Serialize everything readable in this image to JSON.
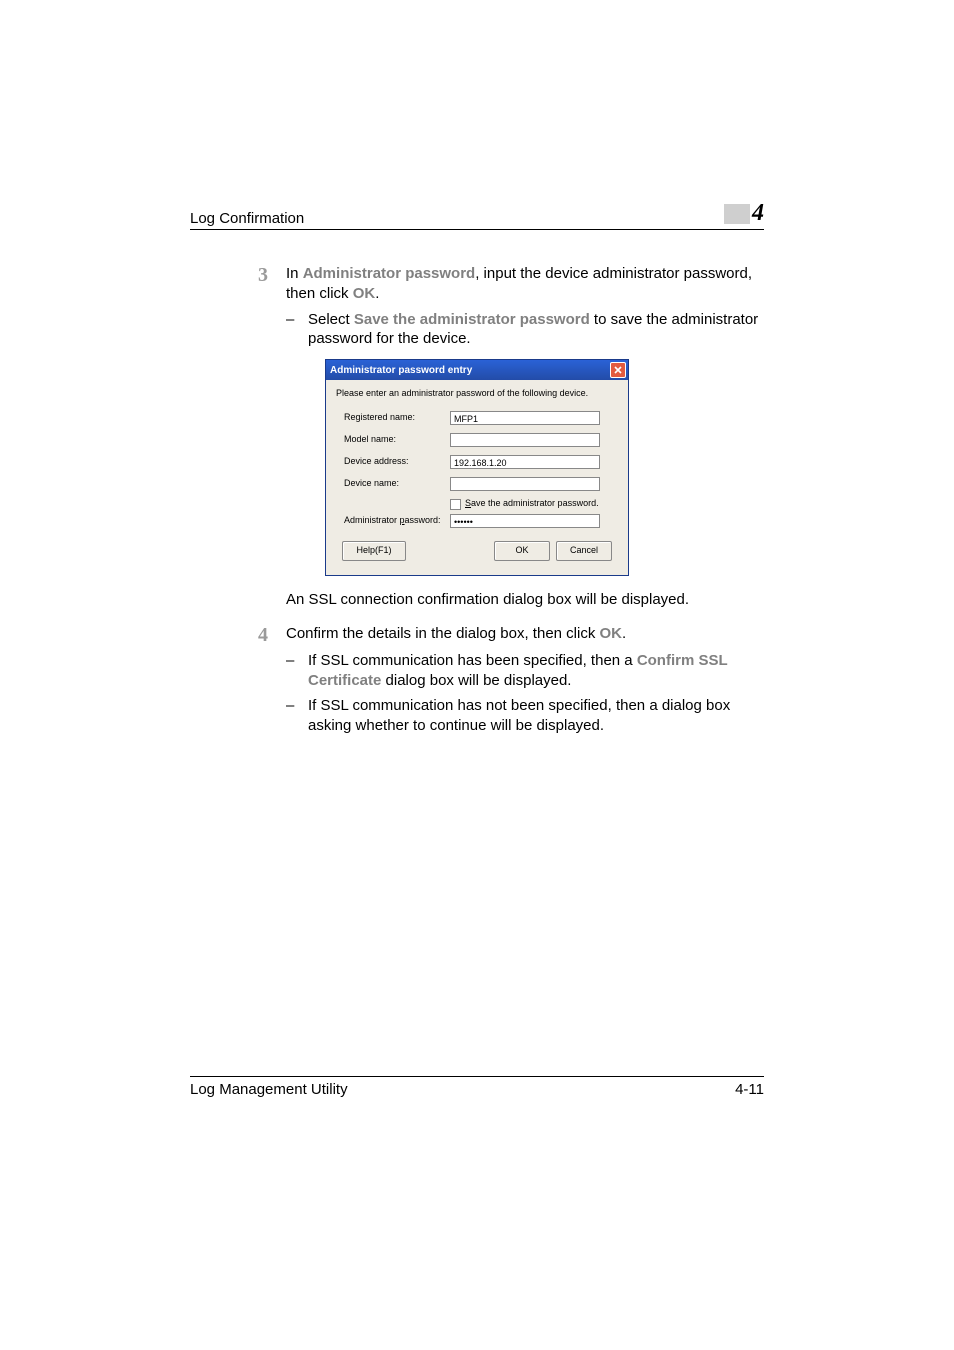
{
  "header": {
    "title": "Log Confirmation",
    "chapter": "4"
  },
  "steps": {
    "s3": {
      "num": "3",
      "text_pre": "In ",
      "bold1": "Administrator password",
      "text_mid": ", input the device administrator password, then click ",
      "bold2": "OK",
      "text_end": ".",
      "sub1_pre": "Select ",
      "sub1_bold": "Save the administrator password",
      "sub1_post": " to save the administrator password for the device."
    },
    "s4": {
      "num": "4",
      "text_pre": "Confirm the details in the dialog box, then click ",
      "bold1": "OK",
      "text_end": ".",
      "sub1_pre": "If SSL communication has been specified, then a ",
      "sub1_bold": "Confirm SSL Certificate",
      "sub1_post": " dialog box will be displayed.",
      "sub2": "If SSL communication has not been specified, then a dialog box asking whether to continue will be displayed."
    }
  },
  "dialog": {
    "title": "Administrator password entry",
    "instruction": "Please enter an administrator password of the following device.",
    "labels": {
      "registered": "Registered name:",
      "model": "Model name:",
      "address": "Device address:",
      "devicename": "Device name:",
      "adminpass_prefix": "Administrator ",
      "adminpass_u": "p",
      "adminpass_suffix": "assword:"
    },
    "values": {
      "registered": "MFP1",
      "model": "",
      "address": "192.168.1.20",
      "devicename": "",
      "adminpass": "••••••"
    },
    "checkbox_pre_u": "S",
    "checkbox_label": "ave the administrator password.",
    "buttons": {
      "help": "Help(F1)",
      "ok": "OK",
      "cancel": "Cancel"
    }
  },
  "after_dialog": "An SSL connection confirmation dialog box will be displayed.",
  "footer": {
    "left": "Log Management Utility",
    "right": "4-11"
  },
  "dash": "–"
}
